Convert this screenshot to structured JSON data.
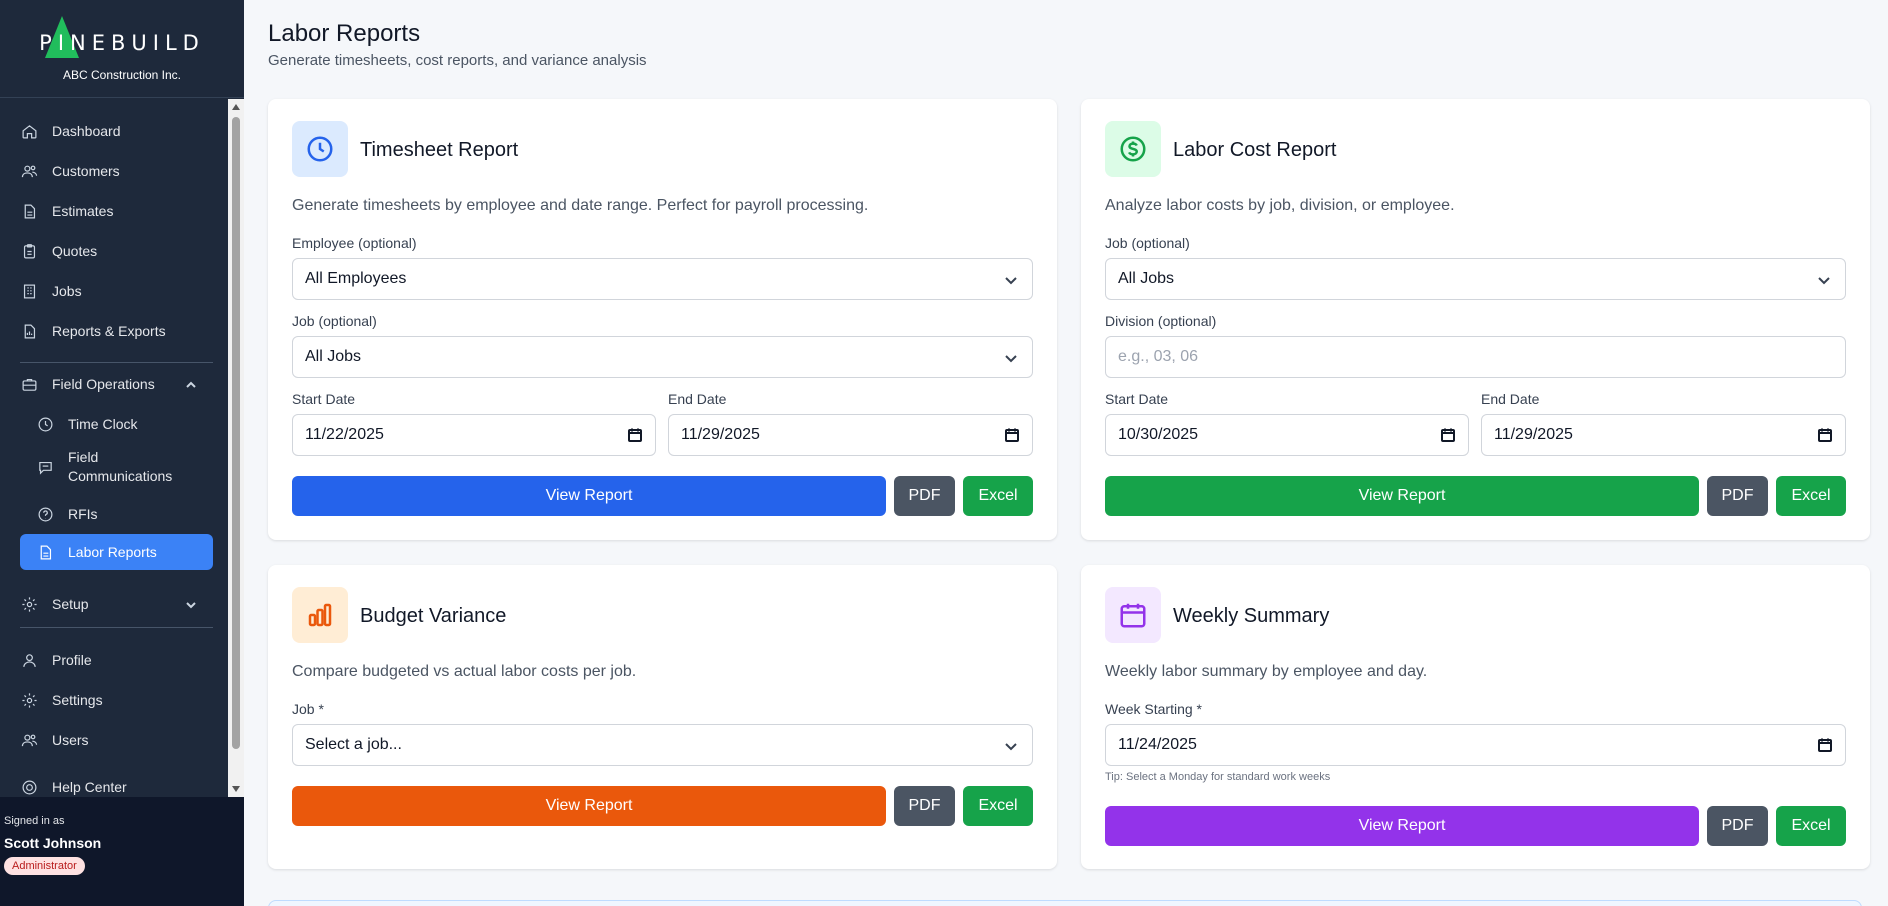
{
  "brand": {
    "logo_text": "PINEBUILD",
    "company": "ABC Construction Inc."
  },
  "nav": {
    "dashboard": "Dashboard",
    "customers": "Customers",
    "estimates": "Estimates",
    "quotes": "Quotes",
    "jobs": "Jobs",
    "reports": "Reports & Exports",
    "field_operations": "Field Operations",
    "time_clock": "Time Clock",
    "field_communications": "Field Communications",
    "rfis": "RFIs",
    "labor_reports": "Labor Reports",
    "setup": "Setup",
    "profile": "Profile",
    "settings": "Settings",
    "users": "Users",
    "help_center": "Help Center"
  },
  "user": {
    "signed_in_as": "Signed in as",
    "name": "Scott Johnson",
    "role": "Administrator"
  },
  "page": {
    "title": "Labor Reports",
    "subtitle": "Generate timesheets, cost reports, and variance analysis"
  },
  "buttons": {
    "view_report": "View Report",
    "pdf": "PDF",
    "excel": "Excel"
  },
  "timesheet": {
    "title": "Timesheet Report",
    "description": "Generate timesheets by employee and date range. Perfect for payroll processing.",
    "employee_label": "Employee (optional)",
    "employee_value": "All Employees",
    "job_label": "Job (optional)",
    "job_value": "All Jobs",
    "start_label": "Start Date",
    "start_value": "11/22/2025",
    "end_label": "End Date",
    "end_value": "11/29/2025"
  },
  "labor_cost": {
    "title": "Labor Cost Report",
    "description": "Analyze labor costs by job, division, or employee.",
    "job_label": "Job (optional)",
    "job_value": "All Jobs",
    "division_label": "Division (optional)",
    "division_placeholder": "e.g., 03, 06",
    "start_label": "Start Date",
    "start_value": "10/30/2025",
    "end_label": "End Date",
    "end_value": "11/29/2025"
  },
  "budget": {
    "title": "Budget Variance",
    "description": "Compare budgeted vs actual labor costs per job.",
    "job_label": "Job *",
    "job_value": "Select a job..."
  },
  "weekly": {
    "title": "Weekly Summary",
    "description": "Weekly labor summary by employee and day.",
    "week_label": "Week Starting *",
    "week_value": "11/24/2025",
    "tip": "Tip: Select a Monday for standard work weeks"
  },
  "colors": {
    "blue": "#2563eb",
    "green": "#16a34a",
    "orange": "#ea580c",
    "purple": "#9333ea",
    "gray": "#4b5563",
    "sidebar": "#1e293b"
  },
  "icons": {
    "timesheet": "clock-icon",
    "labor_cost": "dollar-circle-icon",
    "budget": "bar-chart-icon",
    "weekly": "calendar-icon"
  }
}
